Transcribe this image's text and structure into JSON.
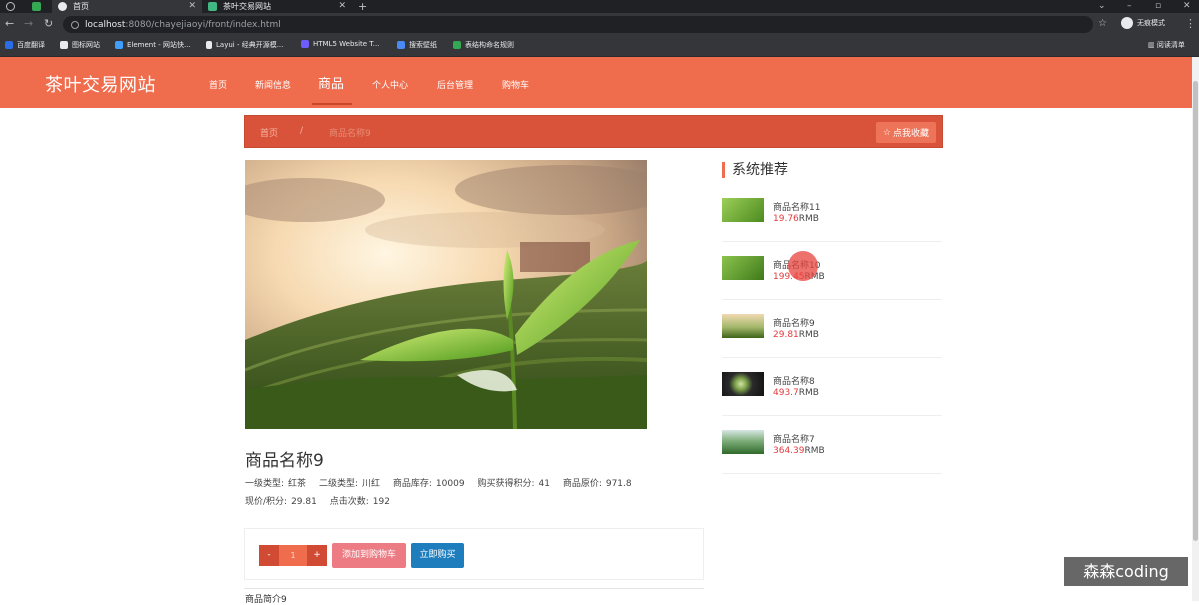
{
  "browser": {
    "tabs": [
      {
        "title": "首页",
        "active": true
      },
      {
        "title": "茶叶交易网站",
        "active": false
      }
    ],
    "url_host": "localhost",
    "url_path": ":8080/chayejiaoyi/front/index.html",
    "profile_label": "无痕模式",
    "bookmarks": [
      "百度翻译",
      "图标网站",
      "Element - 网站快...",
      "Layui - 经典开源模...",
      "HTML5 Website T...",
      "搜索壁纸",
      "表结构命名规则"
    ],
    "reading_list": "阅读清单"
  },
  "site": {
    "brand": "茶叶交易网站",
    "nav": [
      "首页",
      "新闻信息",
      "商品",
      "个人中心",
      "后台管理",
      "购物车"
    ],
    "active_nav": "商品"
  },
  "breadcrumb": {
    "home": "首页",
    "separator": "/",
    "current": "商品名称9",
    "favorite_button": "点我收藏"
  },
  "product": {
    "name": "商品名称9",
    "meta_line1": [
      {
        "label": "一级类型:",
        "value": "红茶"
      },
      {
        "label": "二级类型:",
        "value": "川红"
      },
      {
        "label": "商品库存:",
        "value": "10009"
      },
      {
        "label": "购买获得积分:",
        "value": "41"
      },
      {
        "label": "商品原价:",
        "value": "971.8"
      }
    ],
    "meta_line2": [
      {
        "label": "现价/积分:",
        "value": "29.81"
      },
      {
        "label": "点击次数:",
        "value": "192"
      }
    ],
    "quantity": "1",
    "minus_label": "-",
    "plus_label": "+",
    "add_to_cart": "添加到购物车",
    "buy_now": "立即购买",
    "intro_heading": "商品简介9"
  },
  "recommendations": {
    "title": "系统推荐",
    "unit": "RMB",
    "items": [
      {
        "name": "商品名称11",
        "price": "19.76"
      },
      {
        "name": "商品名称10",
        "price": "199.45"
      },
      {
        "name": "商品名称9",
        "price": "29.81"
      },
      {
        "name": "商品名称8",
        "price": "493.7"
      },
      {
        "name": "商品名称7",
        "price": "364.39"
      }
    ]
  },
  "watermark": "森森coding",
  "colors": {
    "header": "#ef6c4d",
    "breadcrumb": "#d9533a",
    "price": "#e4393c",
    "buy_now": "#1e7dbd",
    "add_cart": "#ed7b83"
  }
}
